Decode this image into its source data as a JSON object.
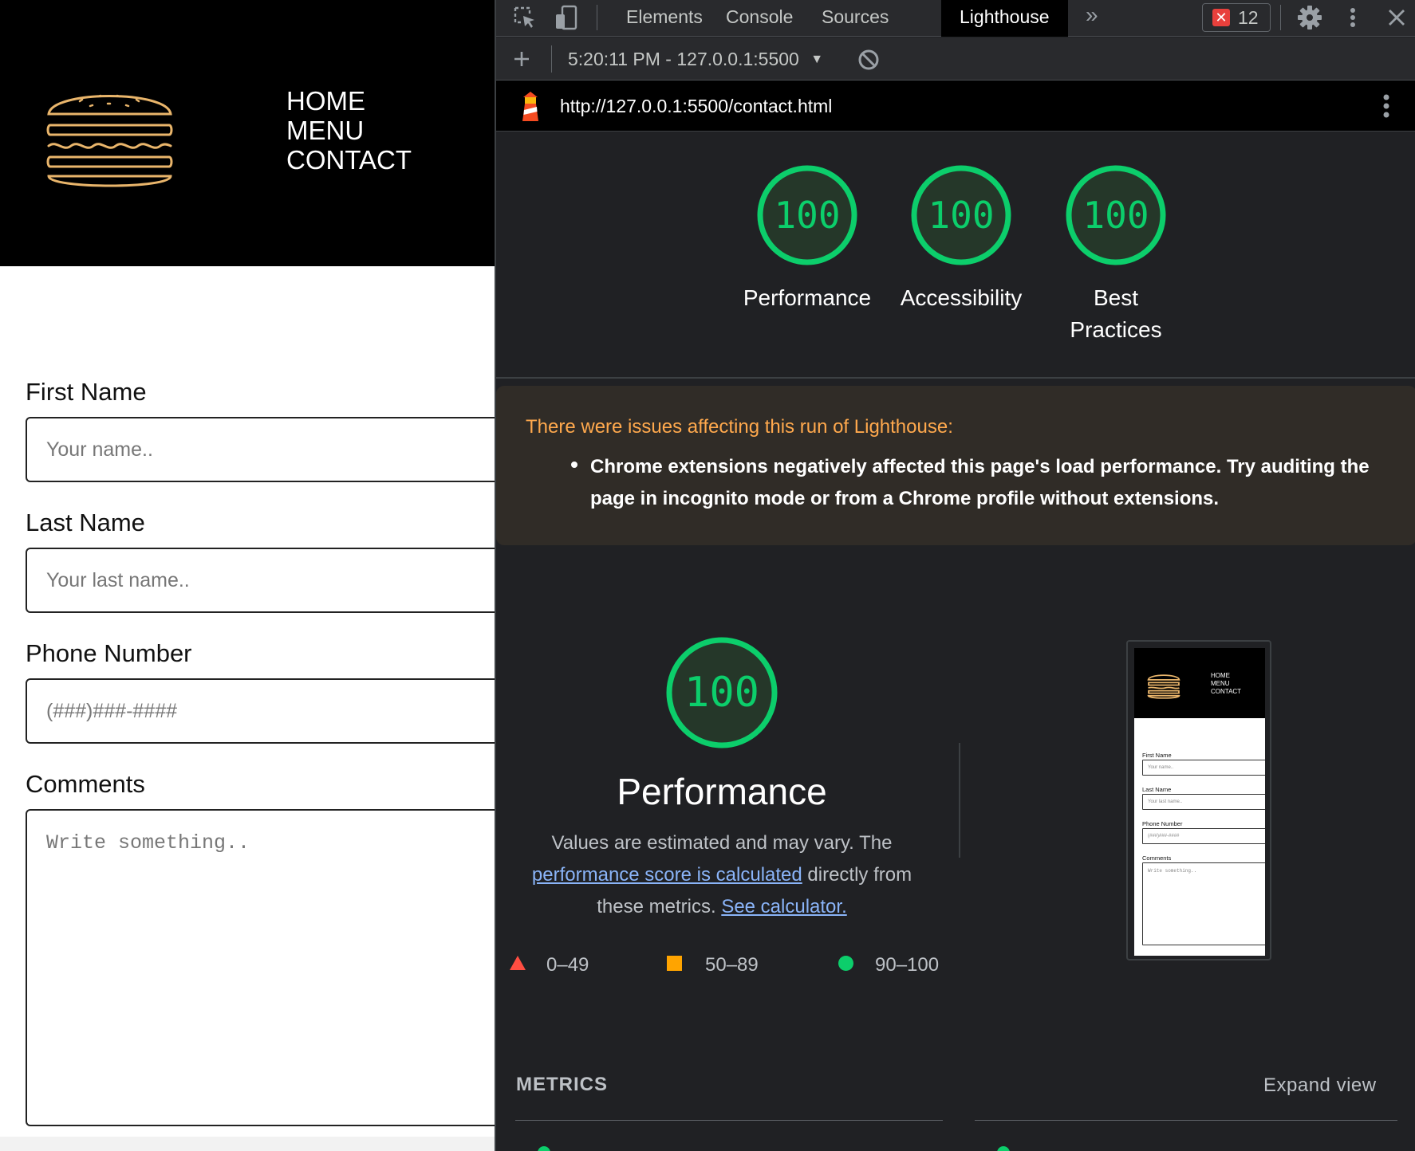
{
  "site": {
    "nav": [
      "HOME",
      "MENU",
      "CONTACT"
    ],
    "form": {
      "first_name_label": "First Name",
      "first_name_placeholder": "Your name..",
      "last_name_label": "Last Name",
      "last_name_placeholder": "Your last name..",
      "phone_label": "Phone Number",
      "phone_placeholder": "(###)###-####",
      "comments_label": "Comments",
      "comments_placeholder": "Write something.."
    }
  },
  "devtools": {
    "tabs": [
      "Elements",
      "Console",
      "Sources",
      "Lighthouse"
    ],
    "active_tab": "Lighthouse",
    "error_count": "12",
    "report_select": "5:20:11 PM - 127.0.0.1:5500",
    "url": "http://127.0.0.1:5500/contact.html",
    "scores": [
      {
        "label": "Performance",
        "score": "100"
      },
      {
        "label": "Accessibility",
        "score": "100"
      },
      {
        "label": "Best Practices",
        "score": "100"
      }
    ],
    "warning": {
      "title": "There were issues affecting this run of Lighthouse:",
      "item": "Chrome extensions negatively affected this page's load performance. Try auditing the page in incognito mode or from a Chrome profile without extensions."
    },
    "performance": {
      "score": "100",
      "title": "Performance",
      "desc_1": "Values are estimated and may vary. The",
      "link_1": "performance score is calculated",
      "desc_2": "directly from these metrics.",
      "link_2": "See calculator."
    },
    "legend": [
      "0–49",
      "50–89",
      "90–100"
    ],
    "thumbnail": {
      "nav": [
        "HOME",
        "MENU",
        "CONTACT"
      ],
      "labels": [
        "First Name",
        "Last Name",
        "Phone Number",
        "Comments"
      ],
      "placeholders": [
        "Your name..",
        "Your last name..",
        "(###)###-####",
        "Write something.."
      ]
    },
    "metrics_title": "METRICS",
    "expand_view": "Expand view",
    "colors": {
      "pass": "#0cce6b",
      "average": "#ffa400",
      "fail": "#ff4e42",
      "warning_text": "#ffa94d",
      "link": "#8ab4f8"
    }
  }
}
